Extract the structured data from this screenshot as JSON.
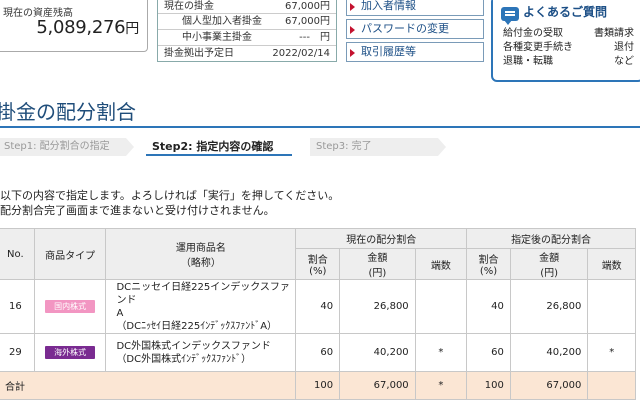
{
  "assets": {
    "label": "現在の資産残高",
    "value": "5,089,276",
    "unit": "円"
  },
  "contributions": {
    "current_label": "現在の掛金",
    "current_value": "67,000円",
    "personal_label": "個人型加入者掛金",
    "personal_value": "67,000円",
    "sme_label": "中小事業主掛金",
    "sme_value": "---　円",
    "next_date_label": "掛金拠出予定日",
    "next_date_value": "2022/02/14"
  },
  "links": [
    {
      "label": "加入者情報"
    },
    {
      "label": "パスワードの変更"
    },
    {
      "label": "取引履歴等"
    }
  ],
  "faq": {
    "title": "よくあるご質問",
    "row1_left": "給付金の受取",
    "row1_right": "書類請求",
    "row2_left": "各種変更手続き",
    "row2_right": "退付",
    "row3_left": "退職・転職",
    "row3_right": "など"
  },
  "page_title": "掛金の配分割合",
  "steps": [
    {
      "label": "Step1: 配分割合の指定"
    },
    {
      "label": "Step2: 指定内容の確認"
    },
    {
      "label": "Step3: 完了"
    }
  ],
  "instructions": {
    "line1": "以下の内容で指定します。よろしければ「実行」を押してください。",
    "line2": "配分割合完了画面まで進まないと受け付けされません。"
  },
  "table": {
    "headers": {
      "no": "No.",
      "type": "商品タイプ",
      "product": "運用商品名",
      "product_sub": "（略称）",
      "current": "現在の配分割合",
      "after": "指定後の配分割合",
      "ratio": "割合",
      "ratio_unit": "(%)",
      "amount": "金額",
      "amount_unit": "(円)",
      "fraction": "端数"
    },
    "rows": [
      {
        "no": "16",
        "type": "国内株式",
        "name1": "DCニッセイ日経225インデックスファンド",
        "name2": "A",
        "name3": "（DCﾆｯｾｲ日経225ｲﾝﾃﾞｯｸｽﾌｧﾝﾄﾞA）",
        "cur_ratio": "40",
        "cur_amount": "26,800",
        "cur_frac": "",
        "new_ratio": "40",
        "new_amount": "26,800",
        "new_frac": ""
      },
      {
        "no": "29",
        "type": "海外株式",
        "name1": "DC外国株式インデックスファンド",
        "name2": "",
        "name3": "（DC外国株式ｲﾝﾃﾞｯｸｽﾌｧﾝﾄﾞ）",
        "cur_ratio": "60",
        "cur_amount": "40,200",
        "cur_frac": "*",
        "new_ratio": "60",
        "new_amount": "40,200",
        "new_frac": "*"
      }
    ],
    "total": {
      "label": "合計",
      "cur_ratio": "100",
      "cur_amount": "67,000",
      "cur_frac": "*",
      "new_ratio": "100",
      "new_amount": "67,000"
    }
  }
}
